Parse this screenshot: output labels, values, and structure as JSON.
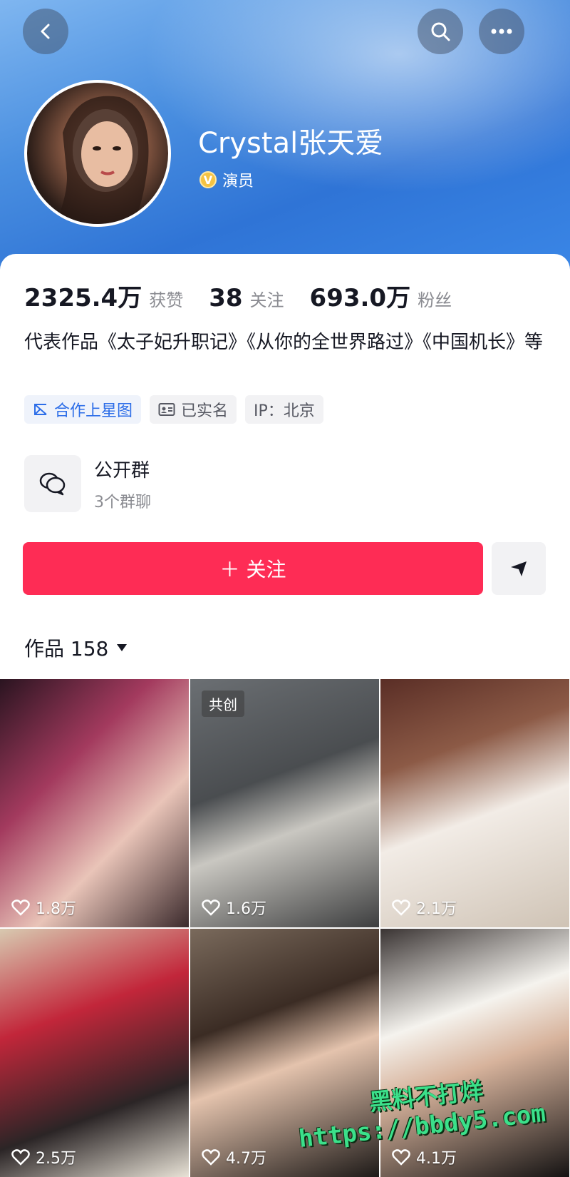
{
  "header": {
    "back_icon": "chevron-left-icon",
    "search_icon": "search-icon",
    "more_icon": "more-horizontal-icon"
  },
  "profile": {
    "name": "Crystal张天爱",
    "verified_label": "演员",
    "verified_badge": "V"
  },
  "stats": [
    {
      "value": "2325.4万",
      "label": "获赞"
    },
    {
      "value": "38",
      "label": "关注"
    },
    {
      "value": "693.0万",
      "label": "粉丝"
    }
  ],
  "bio": "代表作品《太子妃升职记》《从你的全世界路过》《中国机长》等",
  "tags": [
    {
      "label": "合作上星图",
      "icon": "star-map-icon"
    },
    {
      "label": "已实名",
      "icon": "id-card-icon"
    },
    {
      "label": "IP：北京",
      "icon": ""
    }
  ],
  "group": {
    "title": "公开群",
    "subtitle": "3个群聊",
    "icon": "chat-bubbles-icon"
  },
  "actions": {
    "follow_label": "＋ 关注",
    "share_icon": "send-icon"
  },
  "works": {
    "label": "作品 158"
  },
  "videos": [
    {
      "likes": "1.8万",
      "badge": ""
    },
    {
      "likes": "1.6万",
      "badge": "共创"
    },
    {
      "likes": "2.1万",
      "badge": ""
    },
    {
      "likes": "2.5万",
      "badge": ""
    },
    {
      "likes": "4.7万",
      "badge": ""
    },
    {
      "likes": "4.1万",
      "badge": ""
    }
  ],
  "watermark": {
    "line1": "黑料不打烊",
    "line2": "https://bbdy5.com"
  },
  "colors": {
    "follow": "#fe2c55",
    "accent_blue": "#2d6ee8",
    "hero_blue": "#3a86e6"
  }
}
